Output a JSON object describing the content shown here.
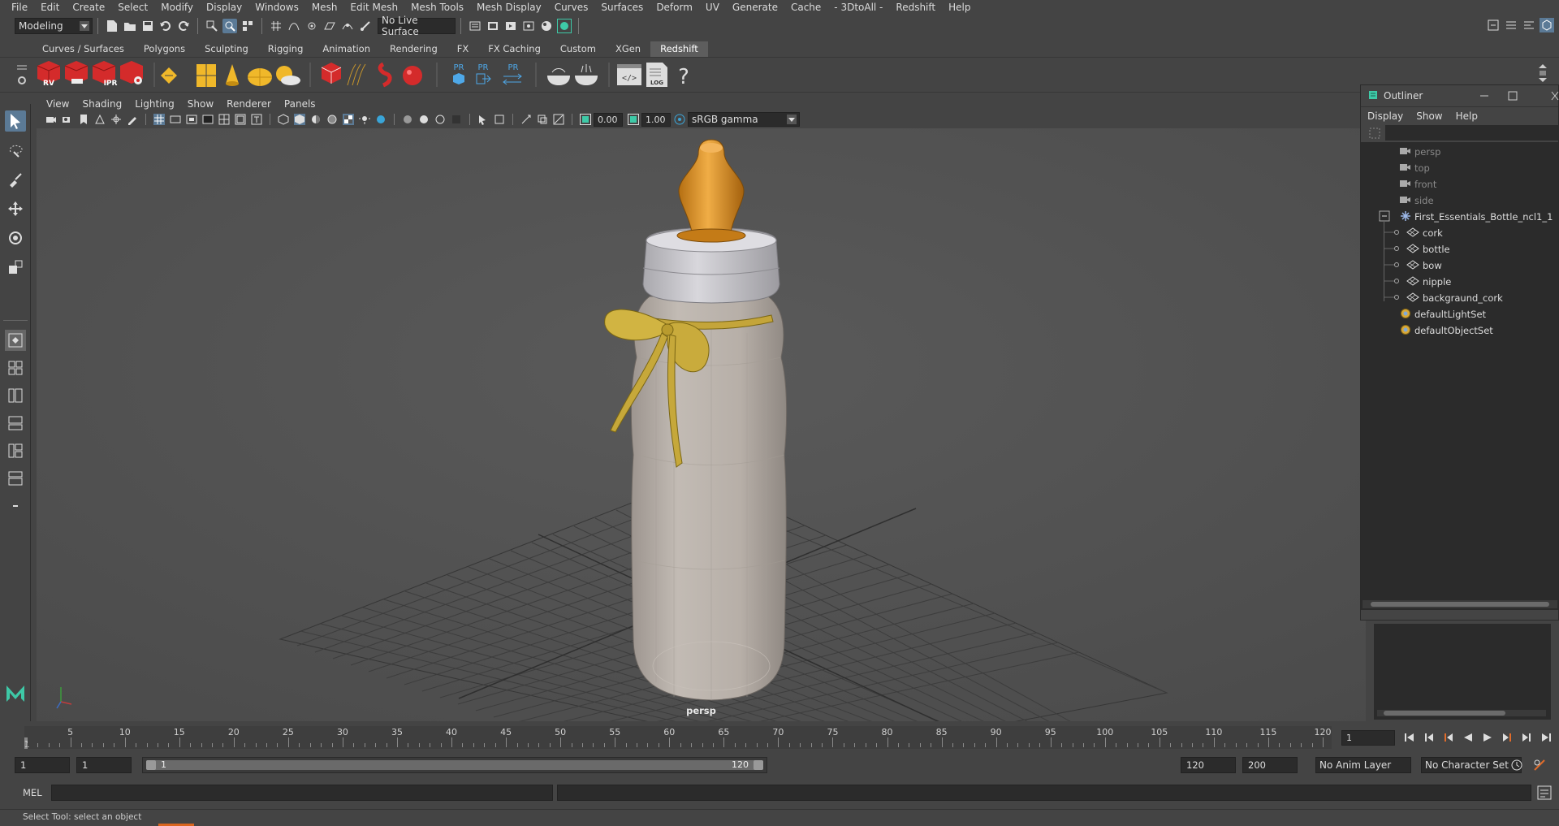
{
  "menubar": {
    "items": [
      "File",
      "Edit",
      "Create",
      "Select",
      "Modify",
      "Display",
      "Windows",
      "Mesh",
      "Edit Mesh",
      "Mesh Tools",
      "Mesh Display",
      "Curves",
      "Surfaces",
      "Deform",
      "UV",
      "Generate",
      "Cache",
      "- 3DtoAll -",
      "Redshift",
      "Help"
    ]
  },
  "statusline": {
    "workspace": "Modeling",
    "live_surface": "No Live Surface"
  },
  "shelf_tabs": {
    "items": [
      "Curves / Surfaces",
      "Polygons",
      "Sculpting",
      "Rigging",
      "Animation",
      "Rendering",
      "FX",
      "FX Caching",
      "Custom",
      "XGen",
      "Redshift"
    ],
    "active": "Redshift"
  },
  "shelf": {
    "rv_label": "RV",
    "ipr_label": "IPR",
    "pr_label": "PR",
    "log_label": "LOG",
    "help_glyph": "?"
  },
  "panel": {
    "menu": [
      "View",
      "Shading",
      "Lighting",
      "Show",
      "Renderer",
      "Panels"
    ],
    "exposure": "0.00",
    "gamma": "1.00",
    "color_space": "sRGB gamma",
    "camera_label": "persp"
  },
  "outliner": {
    "title": "Outliner",
    "menu": [
      "Display",
      "Show",
      "Help"
    ],
    "items": {
      "persp": "persp",
      "top": "top",
      "front": "front",
      "side": "side",
      "group": "First_Essentials_Bottle_ncl1_1",
      "cork": "cork",
      "bottle": "bottle",
      "bow": "bow",
      "nipple": "nipple",
      "backgraund_cork": "backgraund_cork",
      "defaultLightSet": "defaultLightSet",
      "defaultObjectSet": "defaultObjectSet"
    }
  },
  "timeslider": {
    "ticks": [
      "5",
      "10",
      "15",
      "20",
      "25",
      "30",
      "35",
      "40",
      "45",
      "50",
      "55",
      "60",
      "65",
      "70",
      "75",
      "80",
      "85",
      "90",
      "95",
      "100",
      "105",
      "110",
      "115",
      "120"
    ],
    "first_tick": "1",
    "current_frame": "1"
  },
  "range": {
    "start": "1",
    "playback_start": "1",
    "slider_start": "1",
    "slider_end": "120",
    "playback_end": "120",
    "end": "200",
    "anim_layer": "No Anim Layer",
    "character_set": "No Character Set"
  },
  "command": {
    "label": "MEL"
  },
  "helpline": {
    "text": "Select Tool: select an object"
  }
}
